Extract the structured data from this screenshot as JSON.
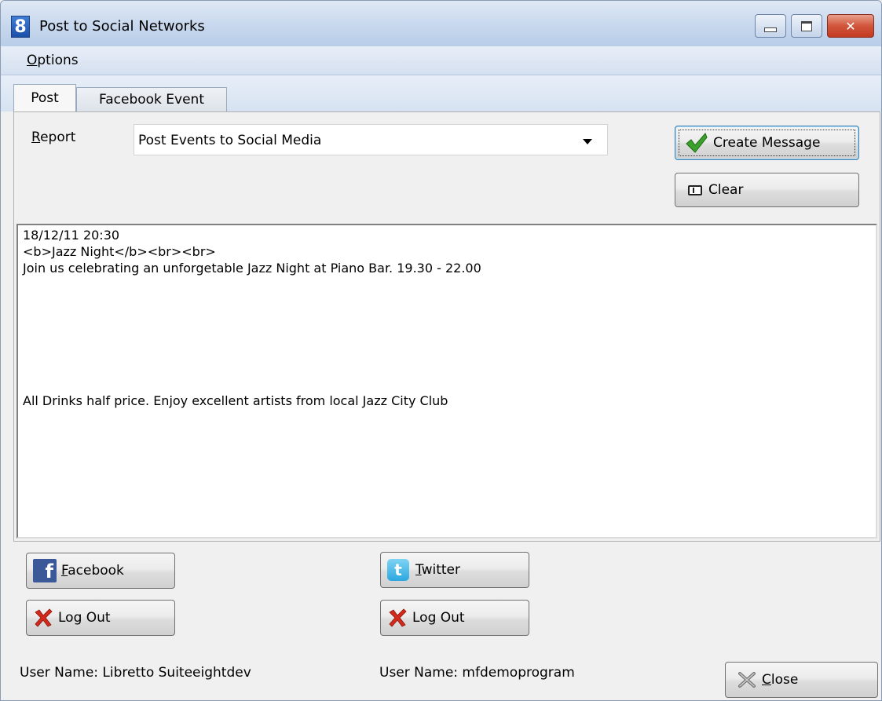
{
  "window": {
    "title": "Post to Social Networks",
    "app_icon_glyph": "8",
    "close_glyph": "✕"
  },
  "menu": {
    "options_label": "Options"
  },
  "tabs": [
    {
      "label": "Post",
      "active": true
    },
    {
      "label": "Facebook Event",
      "active": false
    }
  ],
  "report": {
    "label": "Report",
    "selected": "Post Events to Social Media"
  },
  "buttons": {
    "create_message": "Create Message",
    "clear": "Clear",
    "facebook": "Facebook",
    "twitter": "Twitter",
    "logout_facebook": "Log Out",
    "logout_twitter": "Log Out",
    "close": "Close"
  },
  "message": {
    "line1": "18/12/11 20:30",
    "line2": "<b>Jazz Night</b><br><br>",
    "line3": "Join us celebrating an unforgetable Jazz Night at Piano Bar. 19.30 - 22.00",
    "line4": "All Drinks half price. Enjoy excellent artists from local Jazz City Club"
  },
  "users": {
    "facebook_user": "User Name:  Libretto Suiteeightdev",
    "twitter_user": "User Name: mfdemoprogram"
  },
  "icons": {
    "facebook_glyph": "f",
    "twitter_glyph": "t"
  },
  "colors": {
    "facebook_blue": "#3b5998",
    "twitter_blue": "#2ba8e0",
    "check_green": "#3ba02c",
    "logout_red": "#d42a1c"
  }
}
